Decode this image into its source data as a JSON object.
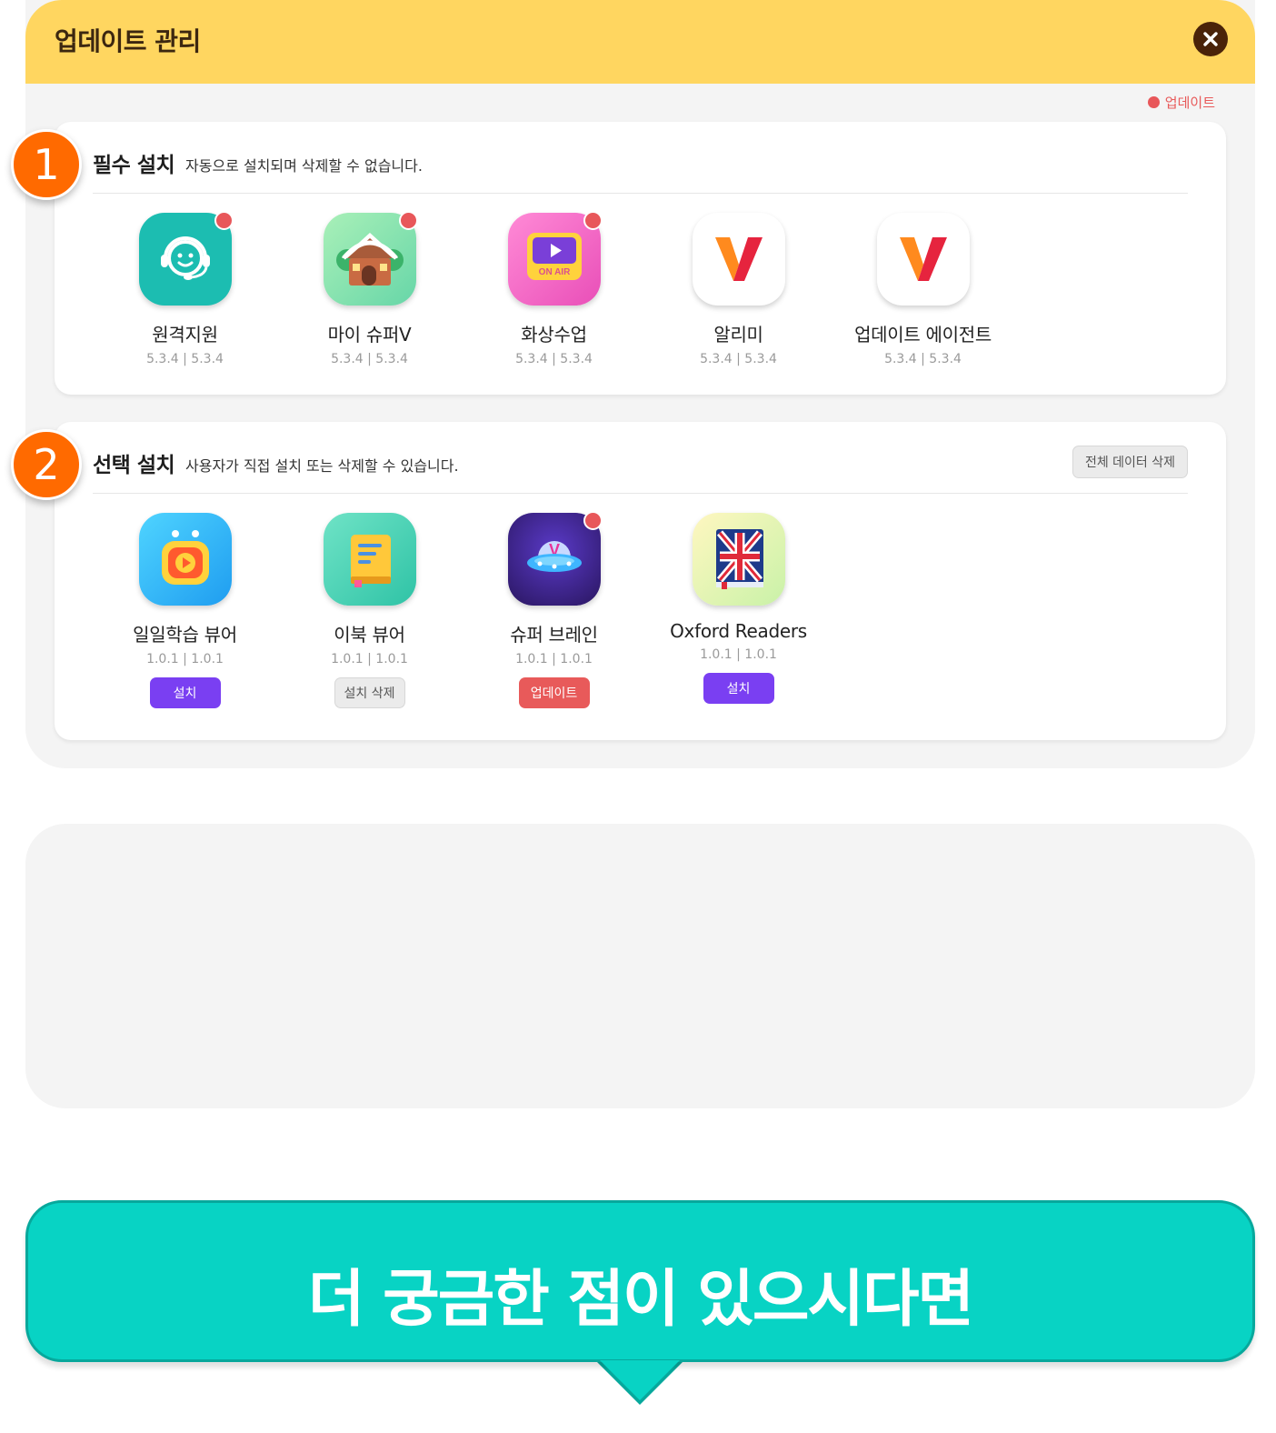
{
  "modal": {
    "title": "업데이트 관리",
    "close_icon": "close-icon",
    "legend_label": "업데이트",
    "legend_color": "#e8575a"
  },
  "sections": [
    {
      "step": "1",
      "title": "필수 설치",
      "description": "자동으로 설치되며 삭제할 수 없습니다.",
      "apps": [
        {
          "name": "원격지원",
          "version": "5.3.4 | 5.3.4",
          "icon": "headset-support-icon",
          "update": true
        },
        {
          "name": "마이 슈퍼V",
          "version": "5.3.4 | 5.3.4",
          "icon": "house-icon",
          "update": true
        },
        {
          "name": "화상수업",
          "version": "5.3.4 | 5.3.4",
          "icon": "video-on-air-icon",
          "icon_text": "ON AIR",
          "update": true
        },
        {
          "name": "알리미",
          "version": "5.3.4 | 5.3.4",
          "icon": "v-logo-icon",
          "update": false
        },
        {
          "name": "업데이트 에이전트",
          "version": "5.3.4 | 5.3.4",
          "icon": "v-logo-icon",
          "update": false
        }
      ]
    },
    {
      "step": "2",
      "title": "선택 설치",
      "description": "사용자가 직접 설치 또는 삭제할 수 있습니다.",
      "delete_all_label": "전체 데이터 삭제",
      "apps": [
        {
          "name": "일일학습 뷰어",
          "version": "1.0.1 | 1.0.1",
          "icon": "tv-play-icon",
          "update": false,
          "button": "설치"
        },
        {
          "name": "이북 뷰어",
          "version": "1.0.1 | 1.0.1",
          "icon": "book-icon",
          "update": false,
          "button": "설치 삭제"
        },
        {
          "name": "슈퍼 브레인",
          "version": "1.0.1 | 1.0.1",
          "icon": "ufo-icon",
          "update": true,
          "button": "업데이트"
        },
        {
          "name": "Oxford Readers",
          "version": "1.0.1 | 1.0.1",
          "icon": "union-jack-book-icon",
          "update": false,
          "button": "설치"
        }
      ]
    }
  ],
  "callout": {
    "text": "더 궁금한 점이 있으시다면",
    "color": "#08d3c4"
  },
  "colors": {
    "header": "#ffd660",
    "step_badge": "#ff6a00",
    "install_button": "#7a3ff2",
    "update_button": "#e85a5a"
  }
}
